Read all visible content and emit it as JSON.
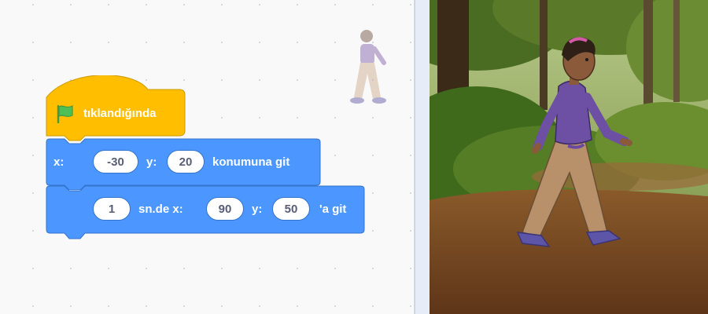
{
  "colors": {
    "events_block": "#ffbf00",
    "motion_block": "#4c97ff",
    "motion_border": "#3373cc",
    "flag_green": "#4cbf56",
    "stage_ground": "#7a4a22",
    "stage_forest": "#3d5a1e"
  },
  "icons": {
    "flag": "green-flag-icon"
  },
  "script": {
    "hat_block": {
      "label": "tıklandığında"
    },
    "goto_block": {
      "x_label": "x:",
      "x_value": "-30",
      "y_label": "y:",
      "y_value": "20",
      "suffix": "konumuna git"
    },
    "glide_block": {
      "secs_value": "1",
      "secs_label": "sn.de x:",
      "x_value": "90",
      "y_label": "y:",
      "y_value": "50",
      "suffix": "'a git"
    }
  }
}
